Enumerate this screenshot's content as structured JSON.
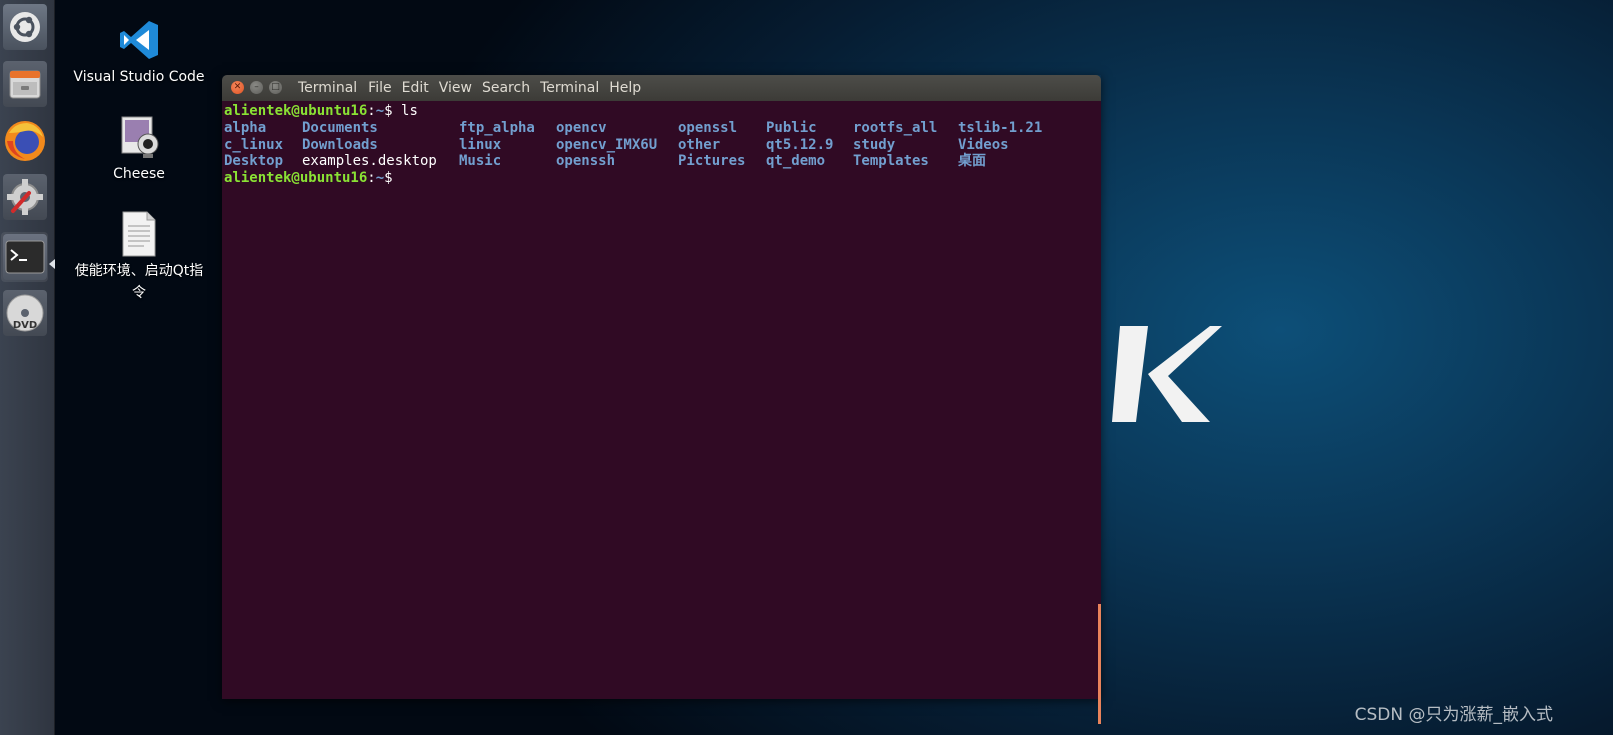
{
  "launcher": {
    "items": [
      {
        "name": "ubuntu-dash-icon"
      },
      {
        "name": "files-icon"
      },
      {
        "name": "firefox-icon"
      },
      {
        "name": "system-settings-icon"
      },
      {
        "name": "terminal-icon"
      },
      {
        "name": "dvd-icon",
        "label": "DVD"
      }
    ]
  },
  "desktop": {
    "icons": [
      {
        "label": "Visual Studio Code"
      },
      {
        "label": "Cheese"
      },
      {
        "label": "使能环境、启动Qt指令"
      }
    ]
  },
  "terminal": {
    "window_title": "Terminal",
    "menu": [
      "File",
      "Edit",
      "View",
      "Search",
      "Terminal",
      "Help"
    ],
    "prompt_user": "alientek@ubuntu16",
    "prompt_sep": ":",
    "prompt_path": "~",
    "prompt_dollar": "$ ",
    "command": "ls",
    "listing": {
      "col1": [
        "alpha",
        "c_linux",
        "Desktop"
      ],
      "col2": [
        "Documents",
        "Downloads",
        "examples.desktop"
      ],
      "col3": [
        "ftp_alpha",
        "linux",
        "Music"
      ],
      "col4": [
        "opencv",
        "opencv_IMX6U",
        "openssh"
      ],
      "col5": [
        "openssl",
        "other",
        "Pictures"
      ],
      "col6": [
        "Public",
        "qt5.12.9",
        "qt_demo"
      ],
      "col7": [
        "rootfs_all",
        "study",
        "Templates"
      ],
      "col8": [
        "tslib-1.21",
        "Videos",
        "桌面"
      ]
    }
  },
  "watermark": "CSDN @只为涨薪_嵌入式",
  "colors": {
    "terminal_bg": "#300a24",
    "prompt_green": "#8ae234",
    "dir_blue": "#729fcf",
    "close_orange": "#e05323"
  }
}
